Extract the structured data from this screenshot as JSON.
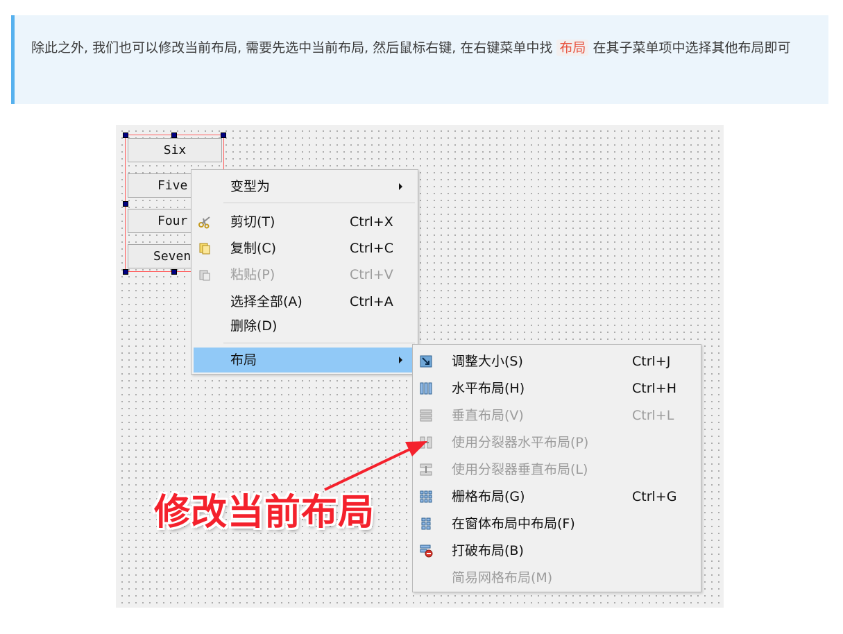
{
  "note": {
    "text_before": "除此之外, 我们也可以修改当前布局, 需要先选中当前布局, 然后鼠标右键, 在右键菜单中找",
    "code": "布局",
    "text_after": "在其子菜单项中选择其他布局即可"
  },
  "canvas": {
    "buttons": [
      "Six",
      "Five",
      "Four",
      "Seven"
    ]
  },
  "context_menu": {
    "items": [
      {
        "label": "变型为",
        "shortcut": "",
        "submenu": true,
        "icon": ""
      },
      {
        "label": "剪切(T)",
        "shortcut": "Ctrl+X",
        "icon": "scissors-icon"
      },
      {
        "label": "复制(C)",
        "shortcut": "Ctrl+C",
        "icon": "copy-icon"
      },
      {
        "label": "粘贴(P)",
        "shortcut": "Ctrl+V",
        "icon": "paste-icon",
        "disabled": true
      },
      {
        "label": "选择全部(A)",
        "shortcut": "Ctrl+A"
      },
      {
        "label": "删除(D)",
        "shortcut": ""
      },
      {
        "label": "布局",
        "shortcut": "",
        "submenu": true,
        "highlighted": true
      }
    ]
  },
  "layout_submenu": {
    "items": [
      {
        "label": "调整大小(S)",
        "shortcut": "Ctrl+J",
        "icon": "adjust-size-icon"
      },
      {
        "label": "水平布局(H)",
        "shortcut": "Ctrl+H",
        "icon": "horizontal-layout-icon"
      },
      {
        "label": "垂直布局(V)",
        "shortcut": "Ctrl+L",
        "icon": "vertical-layout-icon",
        "disabled": true
      },
      {
        "label": "使用分裂器水平布局(P)",
        "shortcut": "",
        "icon": "horizontal-splitter-icon",
        "disabled": true
      },
      {
        "label": "使用分裂器垂直布局(L)",
        "shortcut": "",
        "icon": "vertical-splitter-icon",
        "disabled": true
      },
      {
        "label": "栅格布局(G)",
        "shortcut": "Ctrl+G",
        "icon": "grid-layout-icon"
      },
      {
        "label": "在窗体布局中布局(F)",
        "shortcut": "",
        "icon": "form-layout-icon"
      },
      {
        "label": "打破布局(B)",
        "shortcut": "",
        "icon": "break-layout-icon"
      },
      {
        "label": "简易网格布局(M)",
        "shortcut": "",
        "disabled": true
      }
    ]
  },
  "annotation": {
    "text": "修改当前布局",
    "color": "#f4212c"
  },
  "colors": {
    "highlight": "#91c9f7",
    "note_border": "#56b1ee",
    "selection_handle": "#000080"
  }
}
